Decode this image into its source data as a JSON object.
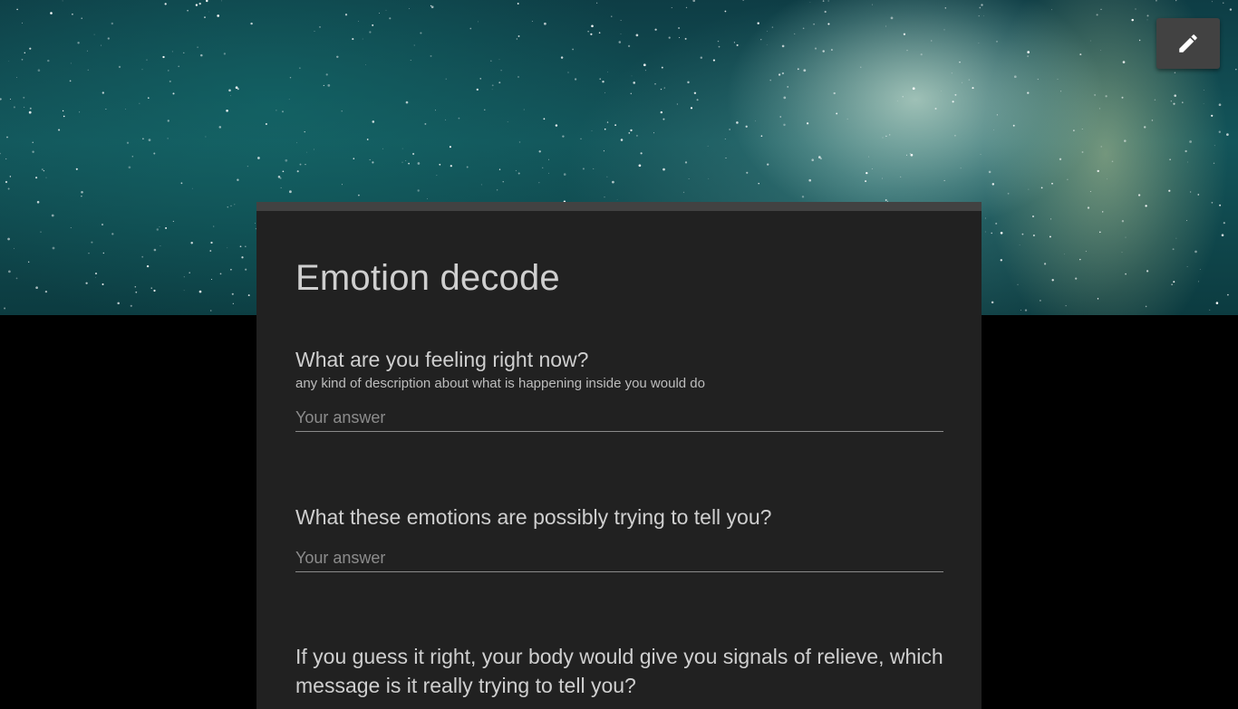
{
  "header": {
    "edit_icon": "pencil-icon"
  },
  "form": {
    "title": "Emotion decode",
    "questions": [
      {
        "label": "What are you feeling right now?",
        "description": "any kind of description about what is happening inside you would do",
        "placeholder": "Your answer"
      },
      {
        "label": "What these emotions are possibly trying to tell you?",
        "placeholder": "Your answer"
      },
      {
        "label": "If you guess it right, your body would give you signals of relieve, which message is it really trying to tell you?"
      }
    ]
  },
  "colors": {
    "page_background": "#000000",
    "card_background": "#212121",
    "card_accent": "#424242",
    "text": "#cfcfcf"
  }
}
